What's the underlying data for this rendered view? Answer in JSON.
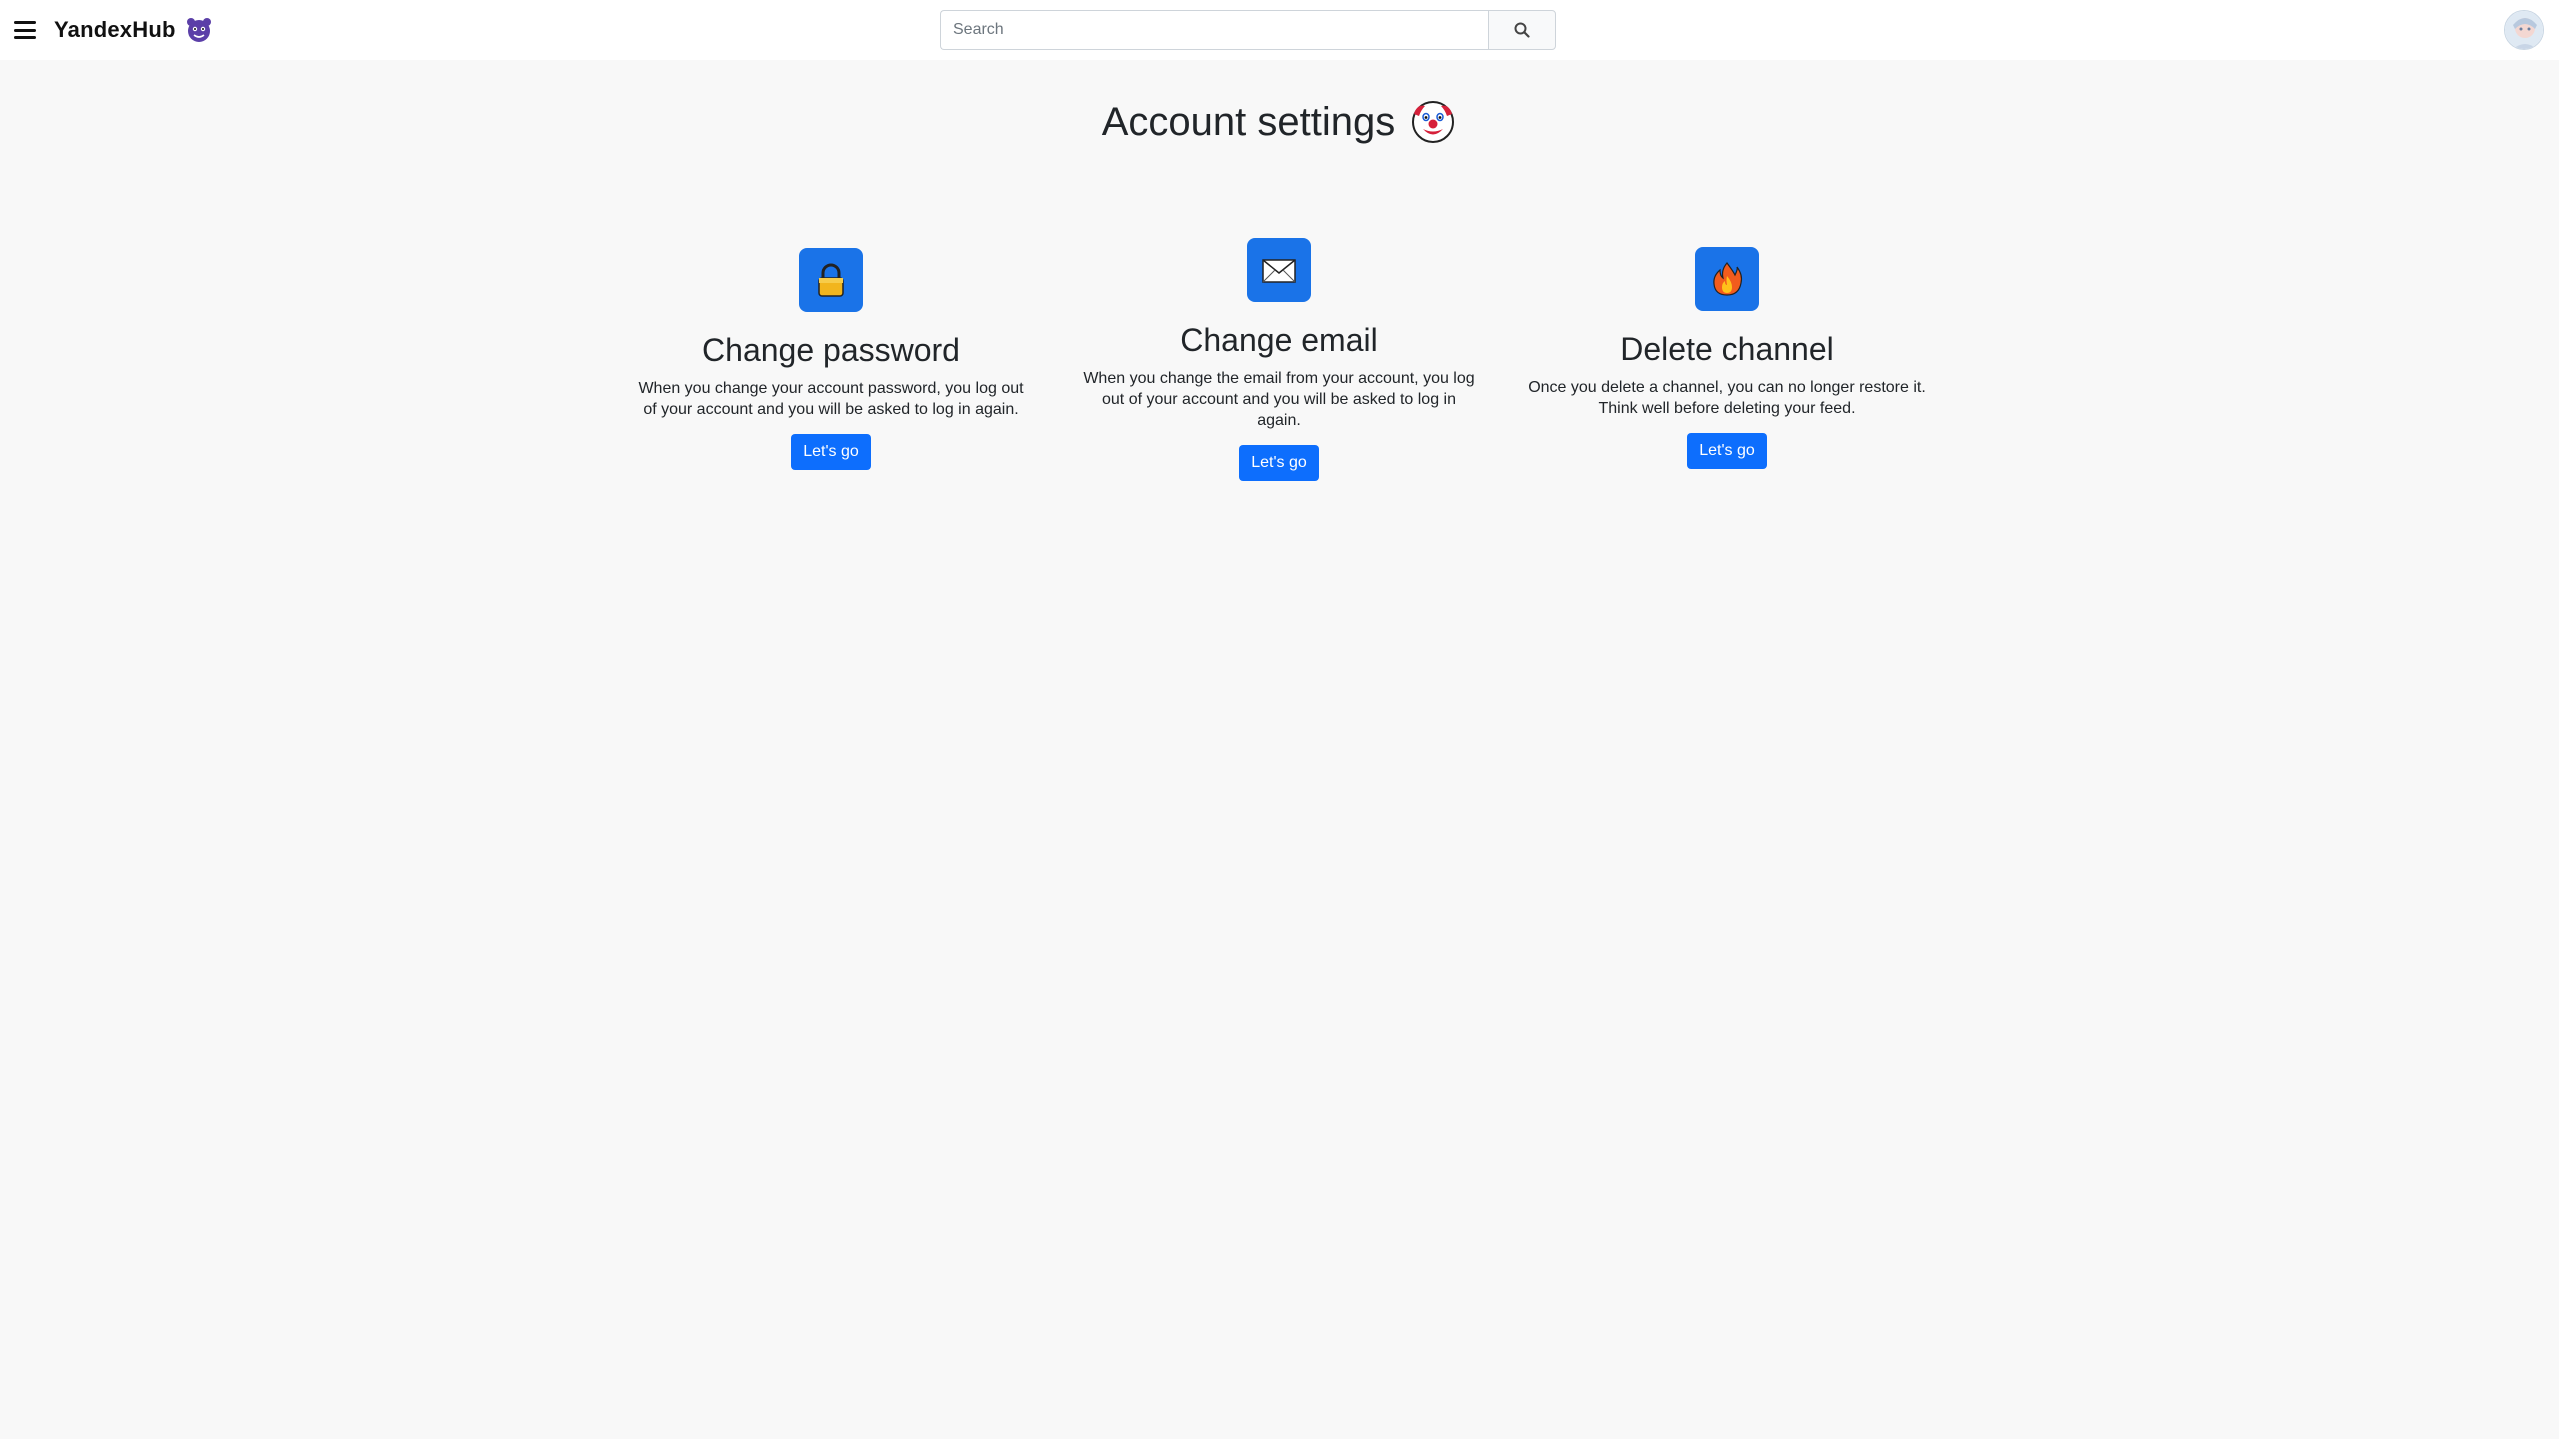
{
  "navbar": {
    "brand": "YandexHub",
    "search_placeholder": "Search"
  },
  "page": {
    "title": "Account settings"
  },
  "cards": [
    {
      "title": "Change password",
      "description": "When you change your account password, you log out of your account and you will be asked to log in again.",
      "button": "Let's go",
      "icon": "lock-icon"
    },
    {
      "title": "Change email",
      "description": "When you change the email from your account, you log out of your account and you will be asked to log in again.",
      "button": "Let's go",
      "icon": "envelope-icon"
    },
    {
      "title": "Delete channel",
      "description": "Once you delete a channel, you can no longer restore it. Think well before deleting your feed.",
      "button": "Let's go",
      "icon": "fire-icon"
    }
  ],
  "colors": {
    "accent": "#0d6efd",
    "icon_tile": "#1a73e8",
    "background": "#f8f8f8"
  }
}
